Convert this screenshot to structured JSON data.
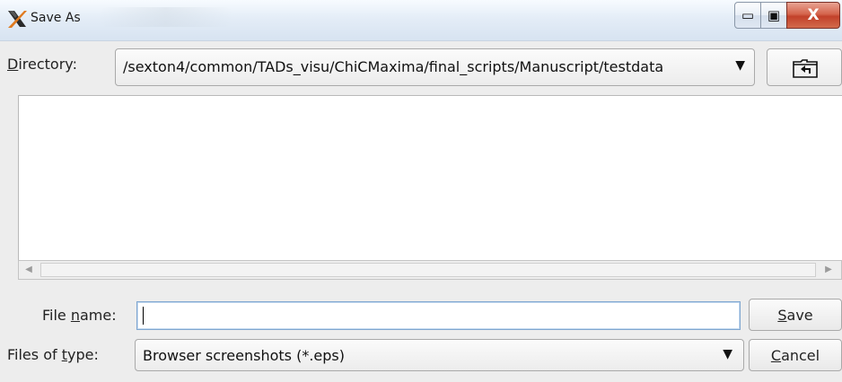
{
  "window": {
    "title": "Save As",
    "icon": "x-window-icon",
    "controls": {
      "minimize_glyph": "▭",
      "maximize_glyph": "▣",
      "close_glyph": "X"
    }
  },
  "directory": {
    "label_prefix": "D",
    "label_rest": "irectory:",
    "path": "/sexton4/common/TADs_visu/ChiCMaxima/final_scripts/Manuscript/testdata",
    "dropdown_icon": "▼",
    "up_folder_icon": "folder-up-icon"
  },
  "file_list": {
    "items": [],
    "scroll_left": "◀",
    "scroll_right": "▶"
  },
  "file_name": {
    "label_before": "File ",
    "label_underlined": "n",
    "label_after": "ame:",
    "value": "",
    "placeholder": ""
  },
  "file_type": {
    "label_before": "Files of ",
    "label_underlined": "t",
    "label_after": "ype:",
    "selected": "Browser screenshots (*.eps)",
    "dropdown_icon": "▼"
  },
  "buttons": {
    "save_underlined": "S",
    "save_rest": "ave",
    "cancel_underlined": "C",
    "cancel_rest": "ancel"
  },
  "colors": {
    "close_button": "#c2412a",
    "titlebar": "#e4edf7",
    "focus_border": "#7fa6d0"
  }
}
